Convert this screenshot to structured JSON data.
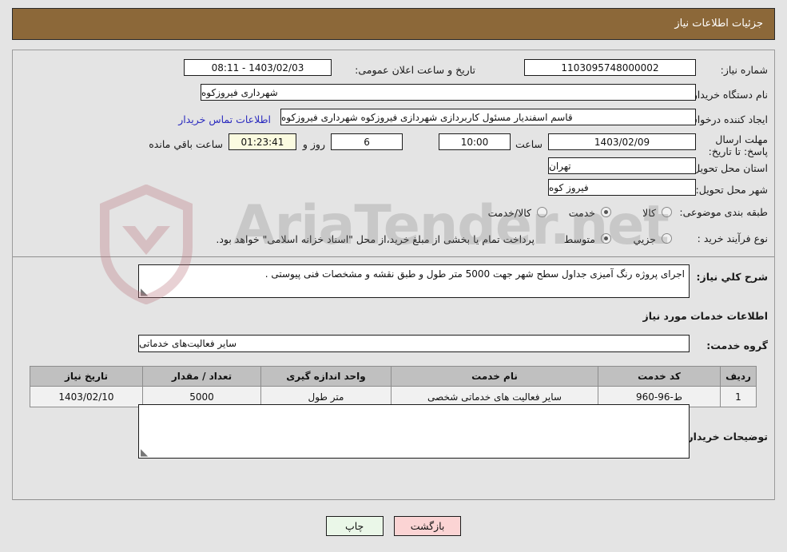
{
  "window": {
    "title": "جزئیات اطلاعات نیاز",
    "title_bg": "#8c6839"
  },
  "watermark": {
    "text": "AriaTender.net",
    "logo_name": "shield-logo"
  },
  "form": {
    "need_number_label": "شماره نیاز:",
    "need_number_value": "1103095748000002",
    "public_announce_label": "تاریخ و ساعت اعلان عمومی:",
    "public_announce_value": "1403/02/03 - 08:11",
    "buyer_org_label": "نام دستگاه خریدار:",
    "buyer_org_value": "شهرداری فیروزکوه",
    "creator_label": "ایجاد کننده درخواست:",
    "creator_value": "قاسم اسفندیار مسئول کاربردازی شهردازی فیروزکوه شهرداری فیروزکوه",
    "contact_link": "اطلاعات تماس خریدار",
    "deadline_label": "مهلت ارسال پاسخ: تا تاریخ:",
    "deadline_date": "1403/02/09",
    "hour_label": "ساعت",
    "deadline_time": "10:00",
    "days_value": "6",
    "days_label": "روز و",
    "countdown_value": "01:23:41",
    "countdown_label": "ساعت باقي مانده",
    "province_label": "استان محل تحویل:",
    "province_value": "تهران",
    "city_label": "شهر محل تحویل:",
    "city_value": "فیروز کوه",
    "category_label": "طبقه بندی موضوعی:",
    "category_options": [
      {
        "label": "کالا",
        "selected": false
      },
      {
        "label": "خدمت",
        "selected": true
      },
      {
        "label": "کالا/خدمت",
        "selected": false
      }
    ],
    "process_label": "نوع فرآیند خرید :",
    "process_options": [
      {
        "label": "جزیي",
        "selected": false
      },
      {
        "label": "متوسط",
        "selected": true
      }
    ],
    "process_note": "پرداخت تمام یا بخشی از مبلغ خرید،از محل \"اسناد خزانه اسلامی\" خواهد بود."
  },
  "description": {
    "label": "شرح کلي نیاز:",
    "value": "اجرای پروژه رنگ آمیزی جداول سطح شهر جهت 5000 متر طول و طبق نقشه و مشخصات فنی پیوستی ."
  },
  "services": {
    "section_title": "اطلاعات خدمات مورد نیاز",
    "group_label": "گروه خدمت:",
    "group_value": "سایر فعالیت‌های خدماتی",
    "columns": [
      "ردیف",
      "کد خدمت",
      "نام خدمت",
      "واحد اندازه گیری",
      "تعداد / مقدار",
      "تاریخ نیاز"
    ],
    "rows": [
      {
        "row": "1",
        "code": "ط-96-960",
        "name": "سایر فعالیت های خدماتی شخصی",
        "unit": "متر طول",
        "quantity": "5000",
        "date": "1403/02/10"
      }
    ]
  },
  "buyer_notes": {
    "label": "توضیحات خریدار:",
    "value": ""
  },
  "buttons": {
    "print": "چاپ",
    "back": "بازگشت"
  }
}
